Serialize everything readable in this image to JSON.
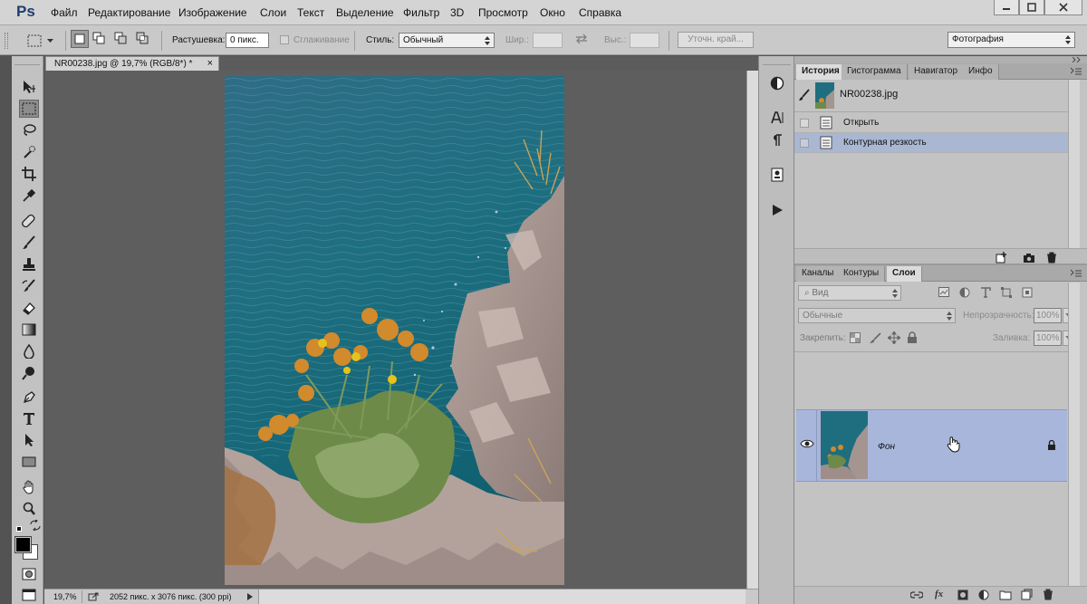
{
  "app": {
    "logo": "Ps"
  },
  "menu": [
    "Файл",
    "Редактирование",
    "Изображение",
    "Слои",
    "Текст",
    "Выделение",
    "Фильтр",
    "3D",
    "Просмотр",
    "Окно",
    "Справка"
  ],
  "options": {
    "feather_label": "Растушевка:",
    "feather_value": "0 пикс.",
    "antialias_label": "Сглаживание",
    "style_label": "Стиль:",
    "style_value": "Обычный",
    "width_label": "Шир.:",
    "height_label": "Выс.:",
    "refine_edge": "Уточн. край...",
    "workspace": "Фотография"
  },
  "document": {
    "tab_title": "NR00238.jpg @ 19,7% (RGB/8*) *",
    "zoom": "19,7%",
    "doc_info": "2052 пикс. x 3076 пикс. (300 ppi)"
  },
  "history_panel": {
    "tabs": [
      "История",
      "Гистограмма",
      "Навигатор",
      "Инфо"
    ],
    "snapshot": "NR00238.jpg",
    "items": [
      "Открыть",
      "Контурная резкость"
    ]
  },
  "layers_panel": {
    "tabs": [
      "Каналы",
      "Контуры",
      "Слои"
    ],
    "filter_placeholder": "Вид",
    "blend_mode": "Обычные",
    "opacity_label": "Непрозрачность:",
    "opacity_value": "100%",
    "lock_label": "Закрепить:",
    "fill_label": "Заливка:",
    "fill_value": "100%",
    "layer_name": "Фон"
  },
  "colors": {
    "selected_row": "#a9b7d3",
    "layer_selected": "#a8b6db",
    "accent": "#1c3f6e"
  }
}
